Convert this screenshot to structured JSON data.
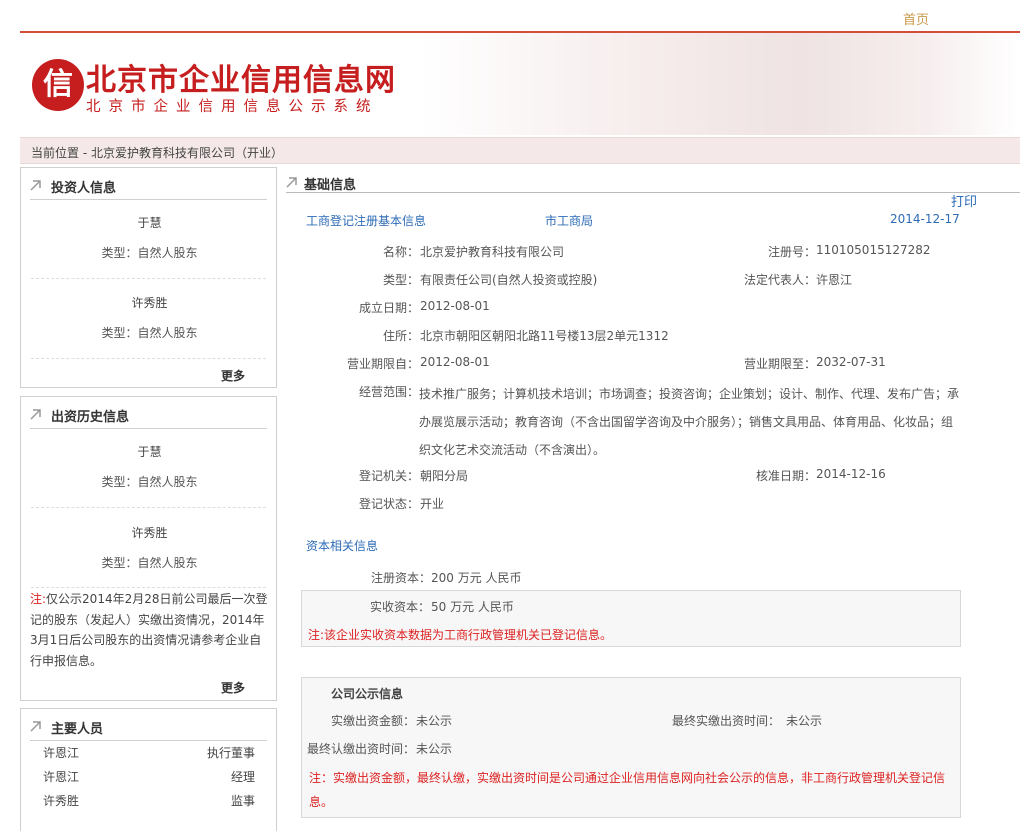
{
  "topnav": {
    "home": "首页"
  },
  "banner": {
    "seal_char": "信",
    "title": "北京市企业信用信息网",
    "subtitle": "北京市企业信用信息公示系统"
  },
  "breadcrumb": "当前位置 - 北京爱护教育科技有限公司（开业）",
  "investor_panel": {
    "title": "投资人信息",
    "items": [
      {
        "name": "于慧",
        "type": "类型：自然人股东"
      },
      {
        "name": "许秀胜",
        "type": "类型：自然人股东"
      }
    ],
    "more": "更多"
  },
  "history_panel": {
    "title": "出资历史信息",
    "items": [
      {
        "name": "于慧",
        "type": "类型：自然人股东"
      },
      {
        "name": "许秀胜",
        "type": "类型：自然人股东"
      }
    ],
    "note_prefix": "注:",
    "note_text": "仅公示2014年2月28日前公司最后一次登记的股东（发起人）实缴出资情况，2014年3月1日后公司股东的出资情况请参考企业自行申报信息。",
    "more": "更多"
  },
  "staff_panel": {
    "title": "主要人员",
    "rows": [
      {
        "name": "许恩江",
        "role": "执行董事"
      },
      {
        "name": "许恩江",
        "role": "经理"
      },
      {
        "name": "许秀胜",
        "role": "监事"
      }
    ]
  },
  "main": {
    "title": "基础信息",
    "print": "打印",
    "section": {
      "name": "工商登记注册基本信息",
      "authority": "市工商局",
      "date": "2014-12-17"
    },
    "fields": {
      "name_label": "名称：",
      "name": "北京爱护教育科技有限公司",
      "regno_label": "注册号：",
      "regno": "110105015127282",
      "type_label": "类型：",
      "type": "有限责任公司(自然人投资或控股)",
      "rep_label": "法定代表人：",
      "rep": "许恩江",
      "found_label": "成立日期：",
      "found": "2012-08-01",
      "addr_label": "住所：",
      "addr": "北京市朝阳区朝阳北路11号楼13层2单元1312",
      "from_label": "营业期限自：",
      "from": "2012-08-01",
      "to_label": "营业期限至：",
      "to": "2032-07-31",
      "scope_label": "经营范围：",
      "scope": "技术推广服务；计算机技术培训；市场调查；投资咨询；企业策划；设计、制作、代理、发布广告；承办展览展示活动；教育咨询（不含出国留学咨询及中介服务）；销售文具用品、体育用品、化妆品；组织文化艺术交流活动（不含演出）。",
      "org_label": "登记机关：",
      "org": "朝阳分局",
      "approve_label": "核准日期：",
      "approve": "2014-12-16",
      "status_label": "登记状态：",
      "status": "开业"
    },
    "capital": {
      "title": "资本相关信息",
      "reg_label": "注册资本：",
      "reg": "200 万元 人民币",
      "paid_label": "实收资本：",
      "paid": "50 万元 人民币",
      "note": "注:该企业实收资本数据为工商行政管理机关已登记信息。"
    },
    "public": {
      "title": "公司公示信息",
      "paid_label": "实缴出资金额：",
      "paid": "未公示",
      "last_paid_label": "最终实缴出资时间：",
      "last_paid": "未公示",
      "last_sub_label": "最终认缴出资时间：",
      "last_sub": "未公示",
      "note": "注：实缴出资金额，最终认缴，实缴出资时间是公司通过企业信用信息网向社会公示的信息，非工商行政管理机关登记信息。"
    }
  },
  "colors": {
    "brand_red": "#c61e1e",
    "link_blue": "#2d6bb5",
    "note_red": "#d22222",
    "home_gold": "#c99a4a"
  }
}
